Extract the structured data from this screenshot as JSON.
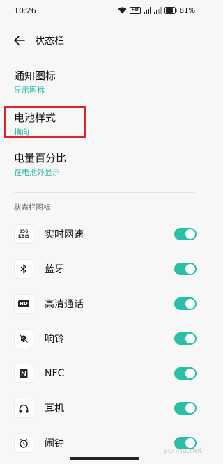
{
  "status_bar": {
    "time": "10:26",
    "battery": "81%",
    "hd": "HD"
  },
  "header": {
    "title": "状态栏"
  },
  "settings": [
    {
      "title": "通知图标",
      "sub": "显示图标"
    },
    {
      "title": "电池样式",
      "sub": "横向"
    },
    {
      "title": "电量百分比",
      "sub": "在电池外显示"
    }
  ],
  "section_label": "状态栏图标",
  "icons_section": [
    {
      "label": "实时网速",
      "icon": "network-speed-icon",
      "icon_text_top": "956",
      "icon_text_bottom": "KB/S",
      "enabled": true
    },
    {
      "label": "蓝牙",
      "icon": "bluetooth-icon",
      "enabled": true
    },
    {
      "label": "高清通话",
      "icon": "hd-call-icon",
      "icon_text": "HD",
      "enabled": true
    },
    {
      "label": "响铃",
      "icon": "bell-off-icon",
      "enabled": true
    },
    {
      "label": "NFC",
      "icon": "nfc-icon",
      "enabled": true
    },
    {
      "label": "耳机",
      "icon": "headphones-icon",
      "enabled": true
    },
    {
      "label": "闹钟",
      "icon": "alarm-icon",
      "enabled": true
    }
  ],
  "watermark": "yunhu.net",
  "colors": {
    "accent": "#2bbfa7",
    "highlight": "#d9262e"
  }
}
